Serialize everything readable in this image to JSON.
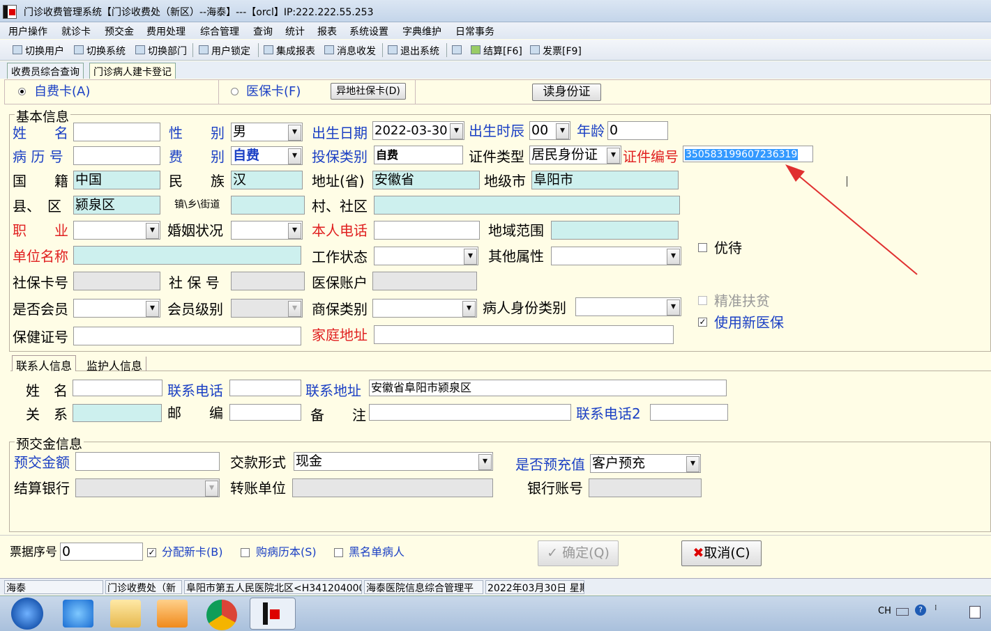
{
  "window": {
    "title": "门诊收费管理系统【门诊收费处（新区）--海泰】---【orcl】IP:222.222.55.253"
  },
  "menu": [
    "用户操作",
    "就诊卡",
    "预交金",
    "费用处理",
    "综合管理",
    "查询",
    "统计",
    "报表",
    "系统设置",
    "字典维护",
    "日常事务"
  ],
  "toolbar": {
    "switch_user": "切换用户",
    "switch_system": "切换系统",
    "switch_dept": "切换部门",
    "lock_user": "用户锁定",
    "report": "集成报表",
    "message": "消息收发",
    "exit": "退出系统",
    "settle": "结算[F6]",
    "invoice": "发票[F9]"
  },
  "tabs": [
    "收费员综合查询",
    "门诊病人建卡登记"
  ],
  "cardtype": {
    "self_pay": "自费卡(A)",
    "medical": "医保卡(F)",
    "remote_btn": "异地社保卡(D)",
    "read_id": "读身份证"
  },
  "basic": {
    "group_title": "基本信息",
    "name_label": "姓　　名",
    "name": "",
    "gender_label": "性　　别",
    "gender": "男",
    "birth_label": "出生日期",
    "birth": "2022-03-30",
    "birth_hour_label": "出生时辰",
    "birth_hour": "00",
    "age_label": "年龄",
    "age": "0",
    "record_label": "病 历 号",
    "record": "",
    "fee_type_label": "费　　别",
    "fee_type": "自费",
    "ins_type_label": "投保类别",
    "ins_type": "自费",
    "id_type_label": "证件类型",
    "id_type": "居民身份证",
    "id_no_label": "证件编号",
    "id_no": "350583199607236319",
    "nation_label": "国　　籍",
    "nation": "中国",
    "ethnic_label": "民　　族",
    "ethnic": "汉",
    "province_label": "地址(省)",
    "province": "安徽省",
    "city_label": "地级市",
    "city": "阜阳市",
    "county_label": "县、　区",
    "county": "颍泉区",
    "town_label": "镇\\乡\\街道",
    "town": "",
    "village_label": "村、社区",
    "village": "",
    "job_label": "职　　业",
    "job": "",
    "marital_label": "婚姻状况",
    "marital": "",
    "phone_label": "本人电话",
    "phone": "",
    "region_label": "地域范围",
    "region": "",
    "company_label": "单位名称",
    "company": "",
    "work_label": "工作状态",
    "work": "",
    "other_label": "其他属性",
    "other": "",
    "social_card_label": "社保卡号",
    "social_card": "",
    "social_no_label": "社 保 号",
    "social_no": "",
    "med_acct_label": "医保账户",
    "med_acct": "",
    "member_label": "是否会员",
    "member": "",
    "member_level_label": "会员级别",
    "member_level": "",
    "biz_ins_label": "商保类别",
    "biz_ins": "",
    "identity_label": "病人身份类别",
    "identity": "",
    "health_label": "保健证号",
    "health": "",
    "home_label": "家庭地址",
    "home": "",
    "discount": "优待",
    "poverty": "精准扶贫",
    "new_ins": "使用新医保"
  },
  "contact": {
    "tabs": [
      "联系人信息",
      "监护人信息"
    ],
    "name_label": "姓　名",
    "name": "",
    "phone_label": "联系电话",
    "phone": "",
    "addr_label": "联系地址",
    "addr": "安徽省阜阳市颍泉区",
    "rel_label": "关　系",
    "rel": "",
    "zip_label": "邮　　编",
    "zip": "",
    "note_label": "备　　注",
    "note": "",
    "phone2_label": "联系电话2",
    "phone2": ""
  },
  "prepay": {
    "group_title": "预交金信息",
    "amount_label": "预交金额",
    "amount": "",
    "method_label": "交款形式",
    "method": "现金",
    "precharge_label": "是否预充值",
    "precharge": "客户预充",
    "bank_label": "结算银行",
    "bank": "",
    "transfer_label": "转账单位",
    "transfer": "",
    "account_label": "银行账号",
    "account": ""
  },
  "footer": {
    "ticket_label": "票据序号",
    "ticket": "0",
    "new_card": "分配新卡(B)",
    "buy_record": "购病历本(S)",
    "blacklist": "黑名单病人",
    "ok": "确定(Q)",
    "cancel": "取消(C)"
  },
  "status": [
    "海泰",
    "门诊收费处（新",
    "阜阳市第五人民医院北区<H341204000",
    "海泰医院信息综合管理平",
    "2022年03月30日 星期"
  ],
  "tray": {
    "lang": "CH"
  },
  "colors": {
    "form_bg": "#fffde6",
    "cyan_input": "#cdf0ee",
    "label_blue": "#1a3fc4",
    "label_red": "#e02020",
    "arrow": "#e03030"
  }
}
